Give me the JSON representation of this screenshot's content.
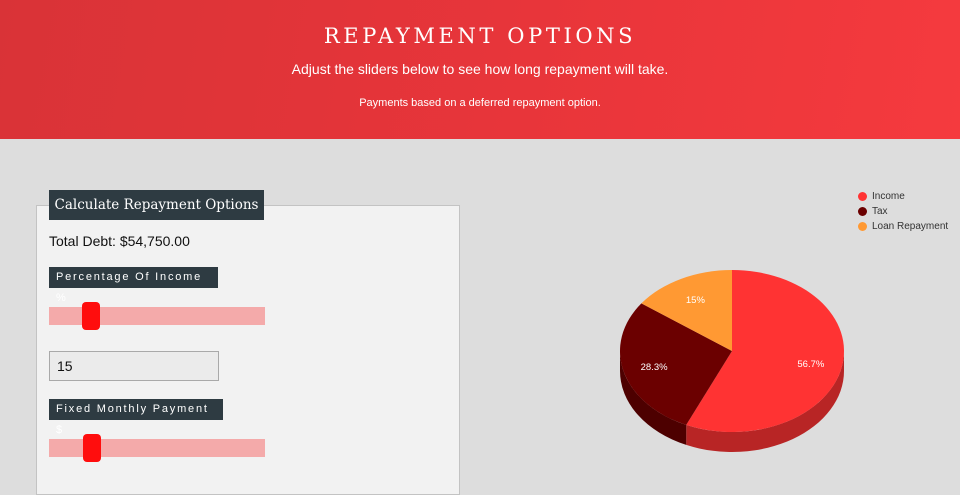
{
  "header": {
    "title": "REPAYMENT OPTIONS",
    "subtitle": "Adjust the sliders below to see how long repayment will take.",
    "note": "Payments based on a deferred repayment option."
  },
  "calculator": {
    "tab_label": "Calculate Repayment Options",
    "total_debt": "Total Debt: $54,750.00",
    "percentage_label": "Percentage Of Income %",
    "percentage_value": "15",
    "fixed_label": "Fixed Monthly Payment $"
  },
  "colors": {
    "header_red": "#e8353a",
    "income": "#ff3333",
    "tax": "#6b0000",
    "loan_repayment": "#ff9933"
  },
  "chart_data": {
    "type": "pie",
    "series": [
      {
        "name": "Income",
        "value": 56.7,
        "label": "56.7%",
        "color": "#ff3333"
      },
      {
        "name": "Tax",
        "value": 28.3,
        "label": "28.3%",
        "color": "#6b0000"
      },
      {
        "name": "Loan Repayment",
        "value": 15,
        "label": "15%",
        "color": "#ff9933"
      }
    ],
    "legend_position": "top-right"
  }
}
